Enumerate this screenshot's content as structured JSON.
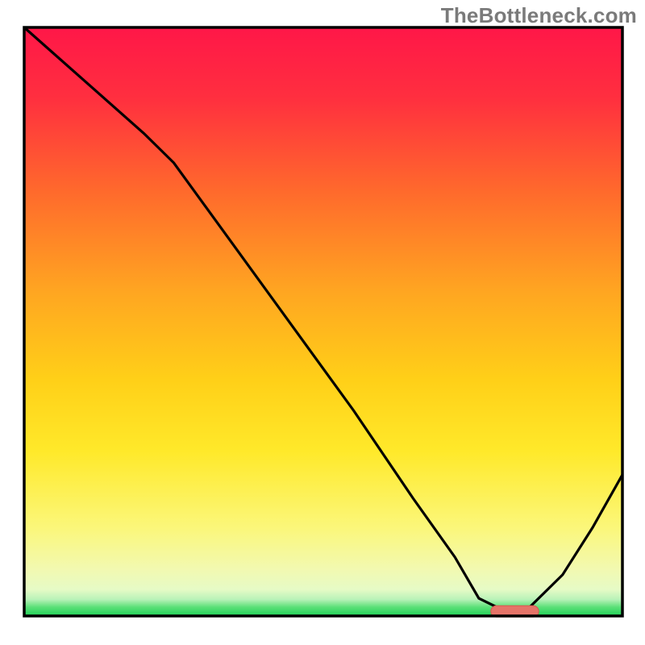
{
  "watermark": "TheBottleneck.com",
  "colors": {
    "stroke_frame": "#000000",
    "curve": "#000000",
    "marker_fill": "#e57368",
    "marker_stroke": "#d85850",
    "gradient_stops": [
      {
        "offset": 0.0,
        "color": "#ff1748"
      },
      {
        "offset": 0.12,
        "color": "#ff2f3f"
      },
      {
        "offset": 0.28,
        "color": "#ff6a2c"
      },
      {
        "offset": 0.45,
        "color": "#ffa621"
      },
      {
        "offset": 0.6,
        "color": "#ffd018"
      },
      {
        "offset": 0.72,
        "color": "#ffe92a"
      },
      {
        "offset": 0.85,
        "color": "#fbf77a"
      },
      {
        "offset": 0.92,
        "color": "#f2f9b0"
      },
      {
        "offset": 0.955,
        "color": "#e6fbc6"
      },
      {
        "offset": 0.972,
        "color": "#b8f2b8"
      },
      {
        "offset": 0.985,
        "color": "#5be077"
      },
      {
        "offset": 1.0,
        "color": "#1fd157"
      }
    ]
  },
  "chart_data": {
    "type": "line",
    "title": "",
    "xlabel": "",
    "ylabel": "",
    "xlim": [
      0,
      100
    ],
    "ylim": [
      0,
      100
    ],
    "categories_note": "No axis ticks or labels are shown; x and y are percentages of the plot area (0 = left/bottom, 100 = right/top).",
    "series": [
      {
        "name": "bottleneck-curve",
        "x": [
          0,
          10,
          20,
          25,
          35,
          45,
          55,
          65,
          72,
          76,
          80,
          84,
          90,
          95,
          100
        ],
        "y": [
          100,
          91,
          82,
          77,
          63,
          49,
          35,
          20,
          10,
          3,
          1,
          1,
          7,
          15,
          24
        ]
      }
    ],
    "marker": {
      "name": "highlight-range",
      "x_start": 78,
      "x_end": 86,
      "y": 0.8,
      "shape": "rounded-bar"
    }
  }
}
